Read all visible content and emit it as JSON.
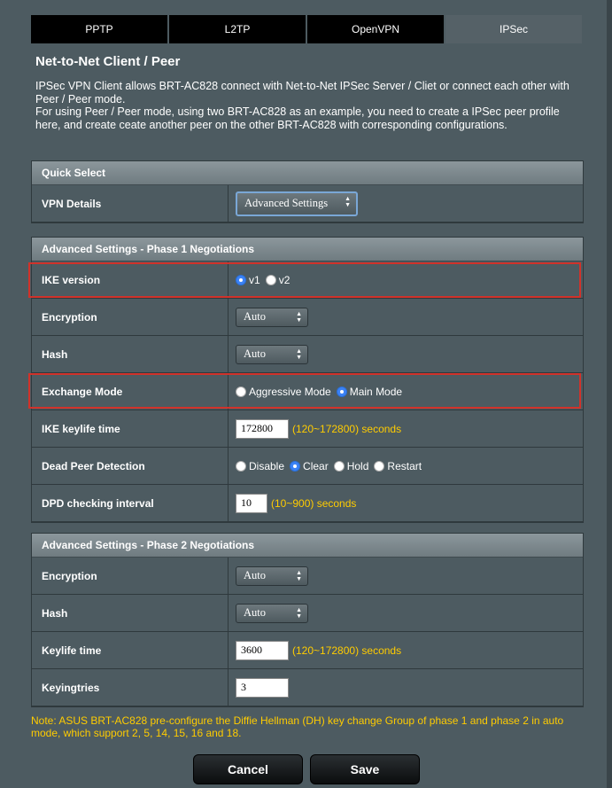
{
  "tabs": [
    {
      "label": "PPTP"
    },
    {
      "label": "L2TP"
    },
    {
      "label": "OpenVPN"
    },
    {
      "label": "IPSec"
    }
  ],
  "title": "Net-to-Net Client / Peer",
  "description": {
    "p1": "IPSec VPN Client allows BRT-AC828 connect with Net-to-Net IPSec Server / Cliet or connect each other with Peer / Peer mode.",
    "p2": "For using Peer / Peer mode, using two BRT-AC828 as an example, you need to create a IPSec peer profile here, and create ceate another peer on the other BRT-AC828 with corresponding configurations."
  },
  "quick_select": {
    "header": "Quick Select",
    "vpn_details_label": "VPN Details",
    "vpn_details_value": "Advanced Settings"
  },
  "phase1": {
    "header": "Advanced Settings - Phase 1 Negotiations",
    "ike_version_label": "IKE version",
    "ike_v1": "v1",
    "ike_v2": "v2",
    "encryption_label": "Encryption",
    "encryption_value": "Auto",
    "hash_label": "Hash",
    "hash_value": "Auto",
    "exchange_label": "Exchange Mode",
    "exchange_aggressive": "Aggressive Mode",
    "exchange_main": "Main Mode",
    "keylife_label": "IKE keylife time",
    "keylife_value": "172800",
    "keylife_hint": "(120~172800) seconds",
    "dpd_label": "Dead Peer Detection",
    "dpd_disable": "Disable",
    "dpd_clear": "Clear",
    "dpd_hold": "Hold",
    "dpd_restart": "Restart",
    "dpd_interval_label": "DPD checking interval",
    "dpd_interval_value": "10",
    "dpd_interval_hint": "(10~900) seconds"
  },
  "phase2": {
    "header": "Advanced Settings - Phase 2 Negotiations",
    "encryption_label": "Encryption",
    "encryption_value": "Auto",
    "hash_label": "Hash",
    "hash_value": "Auto",
    "keylife_label": "Keylife time",
    "keylife_value": "3600",
    "keylife_hint": "(120~172800) seconds",
    "keyingtries_label": "Keyingtries",
    "keyingtries_value": "3"
  },
  "note": "Note: ASUS BRT-AC828 pre-configure the Diffie Hellman (DH) key change Group of phase 1 and phase 2 in auto mode, which support 2, 5, 14, 15, 16 and 18.",
  "buttons": {
    "cancel": "Cancel",
    "save": "Save"
  },
  "colors": {
    "accent": "#3b82f6",
    "highlight": "#d1322a",
    "hint": "#ffcc00"
  }
}
